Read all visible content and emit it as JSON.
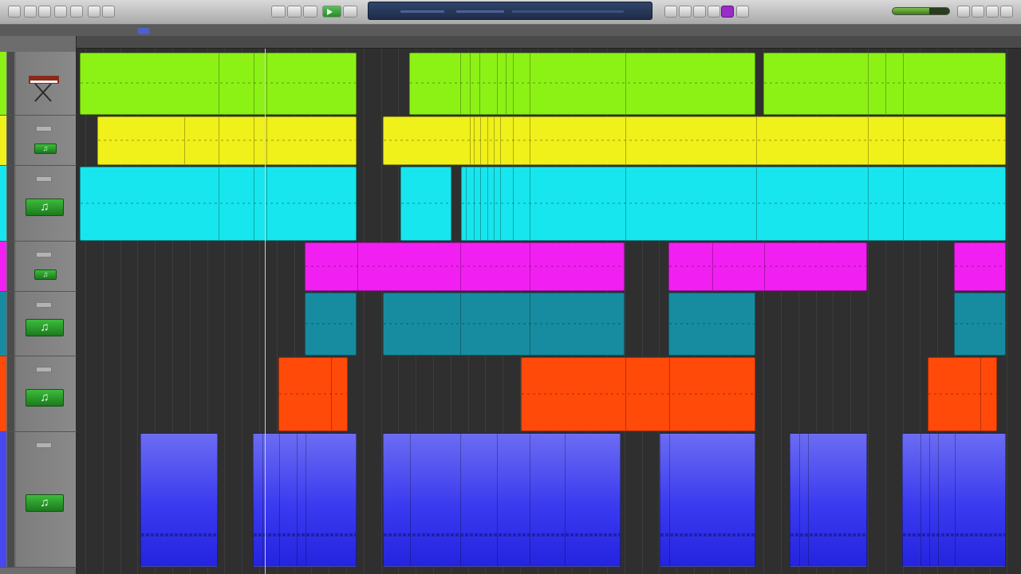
{
  "toolbar": {
    "left_buttons": [
      "close-panel-icon",
      "minimize-icon",
      "zoom-icon",
      "media-icon",
      "record-icon",
      "loop-icon"
    ],
    "transport": [
      "rewind-icon",
      "fast-forward-icon",
      "stop-icon",
      "play-icon",
      "record-icon"
    ],
    "lcd": {
      "position": "",
      "tempo": ""
    },
    "right_buttons": [
      "metronome-icon",
      "tuner-icon",
      "count-in-icon",
      "master-icon",
      "notepad-icon",
      "loops-icon",
      "media-browser-icon"
    ],
    "master_volume": 0.65,
    "colors": {
      "play_active": "#3ea53e",
      "tool_purple": "#9a2bc9",
      "lcd_bg": "#24355a"
    }
  },
  "tracks": [
    {
      "id": "t1",
      "name": "",
      "color": "#8cf216",
      "icon": "electric-piano-icon"
    },
    {
      "id": "t2",
      "name": "",
      "color": "#f0f01a",
      "icon": "drum-machine-icon"
    },
    {
      "id": "t3",
      "name": "",
      "color": "#17e6ee",
      "icon": "software-instrument-icon"
    },
    {
      "id": "t4",
      "name": "",
      "color": "#f21ff2",
      "icon": "drum-machine-icon"
    },
    {
      "id": "t5",
      "name": "",
      "color": "#178ca0",
      "icon": "software-instrument-icon"
    },
    {
      "id": "t6",
      "name": "",
      "color": "#ff4a0a",
      "icon": "software-instrument-icon"
    },
    {
      "id": "t7",
      "name": "",
      "color": "#4848ee",
      "icon": "software-instrument-icon"
    }
  ],
  "region_labels": {
    "t7": ""
  }
}
